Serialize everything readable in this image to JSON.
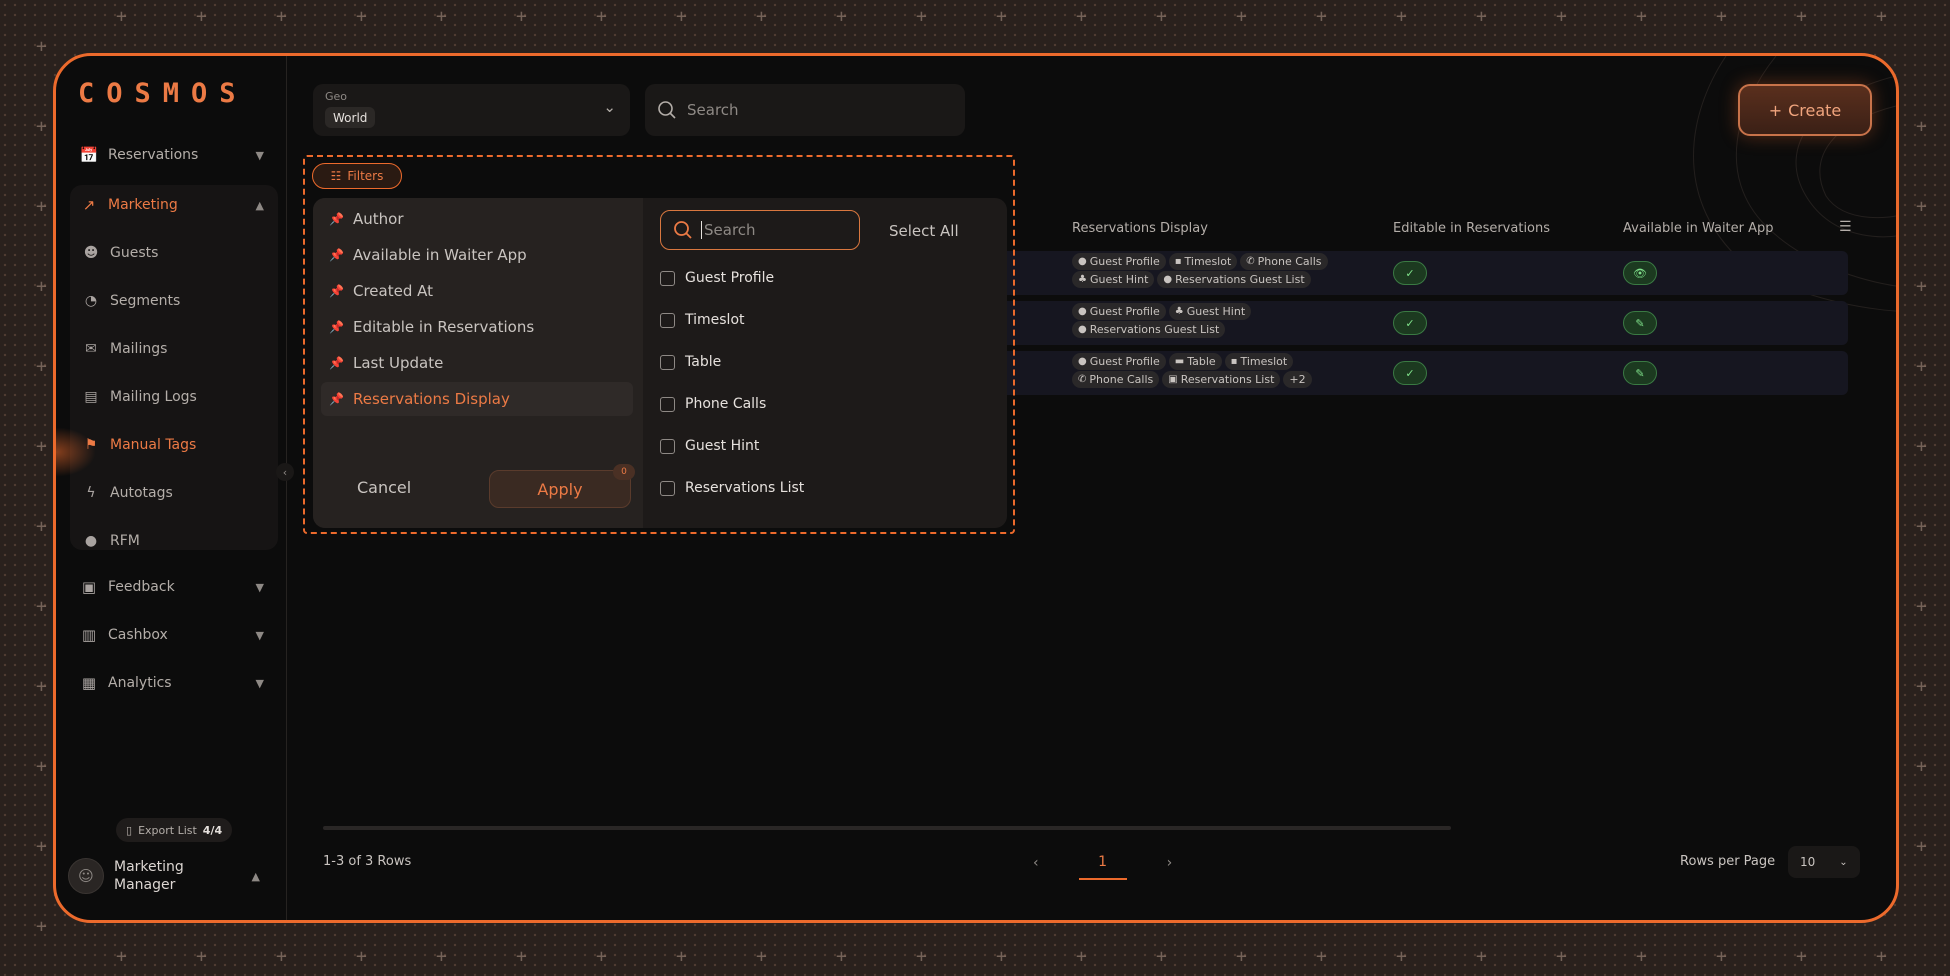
{
  "app": {
    "logo": "COSMOS"
  },
  "sidebar": {
    "items": [
      {
        "label": "Reservations",
        "icon": "calendar-plus-icon"
      },
      {
        "label": "Marketing",
        "icon": "chart-line-icon"
      },
      {
        "label": "Feedback",
        "icon": "chat-icon"
      },
      {
        "label": "Cashbox",
        "icon": "register-icon"
      },
      {
        "label": "Analytics",
        "icon": "presentation-icon"
      }
    ],
    "marketing_sub": [
      {
        "label": "Guests",
        "icon": "smile-icon"
      },
      {
        "label": "Segments",
        "icon": "pie-icon"
      },
      {
        "label": "Mailings",
        "icon": "mail-icon"
      },
      {
        "label": "Mailing Logs",
        "icon": "message-icon"
      },
      {
        "label": "Manual Tags",
        "icon": "tag-user-icon"
      },
      {
        "label": "Autotags",
        "icon": "bolt-icon"
      },
      {
        "label": "RFM",
        "icon": "location-icon"
      }
    ],
    "export": {
      "label": "Export List",
      "count": "4/4"
    },
    "user": {
      "name": "Marketing Manager"
    }
  },
  "topbar": {
    "geo_label": "Geo",
    "geo_value": "World",
    "search_placeholder": "Search",
    "create_label": "Create"
  },
  "table": {
    "headers": [
      "Reservations Display",
      "Editable in Reservations",
      "Available in Waiter App"
    ],
    "rows": [
      {
        "tags": [
          "Guest Profile",
          "Timeslot",
          "Phone Calls",
          "Guest Hint",
          "Reservations Guest List"
        ]
      },
      {
        "tags": [
          "Guest Profile",
          "Guest Hint",
          "Reservations Guest List"
        ]
      },
      {
        "tags": [
          "Guest Profile",
          "Table",
          "Timeslot",
          "Phone Calls",
          "Reservations List",
          "+2"
        ]
      }
    ]
  },
  "footer": {
    "rows_info": "1-3 of 3 Rows",
    "page": "1",
    "rows_per_page_label": "Rows per Page",
    "rows_per_page": "10"
  },
  "filters": {
    "button_label": "Filters",
    "columns": [
      "Author",
      "Available in Waiter App",
      "Created At",
      "Editable in Reservations",
      "Last Update",
      "Reservations Display"
    ],
    "active_index": 5,
    "search_placeholder": "Search",
    "select_all": "Select All",
    "options": [
      "Guest Profile",
      "Timeslot",
      "Table",
      "Phone Calls",
      "Guest Hint",
      "Reservations List"
    ],
    "cancel": "Cancel",
    "apply": "Apply",
    "apply_badge": "0"
  },
  "colors": {
    "accent": "#ec6a2c",
    "success": "#7fe08a"
  }
}
